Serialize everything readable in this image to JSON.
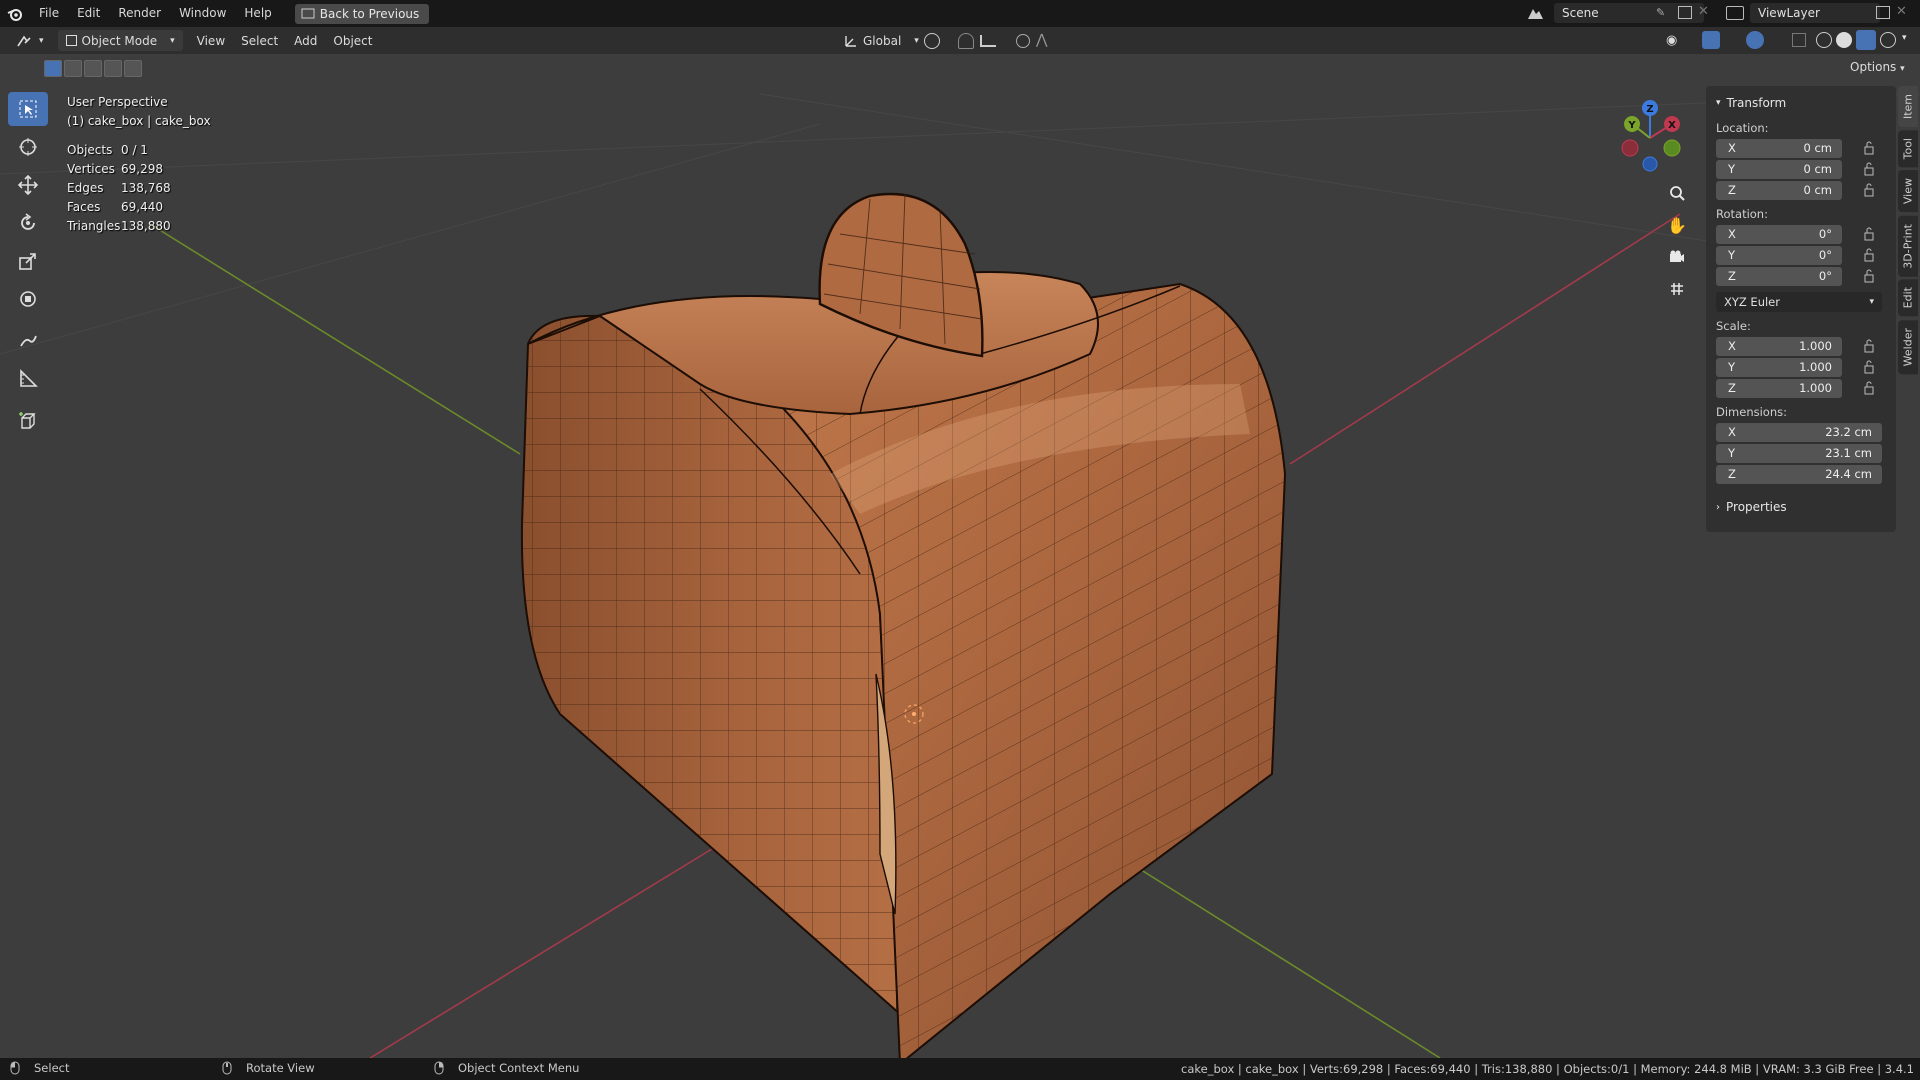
{
  "menubar": {
    "items": [
      "File",
      "Edit",
      "Render",
      "Window",
      "Help"
    ],
    "back_button": "Back to Previous",
    "scene": "Scene",
    "view_layer": "ViewLayer"
  },
  "header": {
    "mode": "Object Mode",
    "menus": [
      "View",
      "Select",
      "Add",
      "Object"
    ],
    "orientation": "Global",
    "options": "Options"
  },
  "overlay": {
    "perspective": "User Perspective",
    "object": "(1) cake_box | cake_box",
    "stats": [
      {
        "key": "Objects",
        "value": "0 / 1"
      },
      {
        "key": "Vertices",
        "value": "69,298"
      },
      {
        "key": "Edges",
        "value": "138,768"
      },
      {
        "key": "Faces",
        "value": "69,440"
      },
      {
        "key": "Triangles",
        "value": "138,880"
      }
    ]
  },
  "npanel": {
    "section": "Transform",
    "location_label": "Location:",
    "location": [
      {
        "axis": "X",
        "value": "0 cm"
      },
      {
        "axis": "Y",
        "value": "0 cm"
      },
      {
        "axis": "Z",
        "value": "0 cm"
      }
    ],
    "rotation_label": "Rotation:",
    "rotation": [
      {
        "axis": "X",
        "value": "0°"
      },
      {
        "axis": "Y",
        "value": "0°"
      },
      {
        "axis": "Z",
        "value": "0°"
      }
    ],
    "rotation_mode": "XYZ Euler",
    "scale_label": "Scale:",
    "scale": [
      {
        "axis": "X",
        "value": "1.000"
      },
      {
        "axis": "Y",
        "value": "1.000"
      },
      {
        "axis": "Z",
        "value": "1.000"
      }
    ],
    "dimensions_label": "Dimensions:",
    "dimensions": [
      {
        "axis": "X",
        "value": "23.2 cm"
      },
      {
        "axis": "Y",
        "value": "23.1 cm"
      },
      {
        "axis": "Z",
        "value": "24.4 cm"
      }
    ],
    "properties": "Properties",
    "tabs": [
      "Item",
      "Tool",
      "View",
      "3D-Print",
      "Edit",
      "Welder"
    ]
  },
  "gizmo": {
    "x": "X",
    "y": "Y",
    "z": "Z"
  },
  "statusbar": {
    "select": "Select",
    "rotate": "Rotate View",
    "context": "Object Context Menu",
    "info": "cake_box | cake_box | Verts:69,298 | Faces:69,440 | Tris:138,880 | Objects:0/1 | Memory: 244.8 MiB | VRAM: 3.3 GiB Free | 3.4.1"
  },
  "colors": {
    "accent": "#4772b3",
    "box": "#b06a43",
    "x_axis": "#a33a4a",
    "y_axis": "#6b8a2a"
  }
}
